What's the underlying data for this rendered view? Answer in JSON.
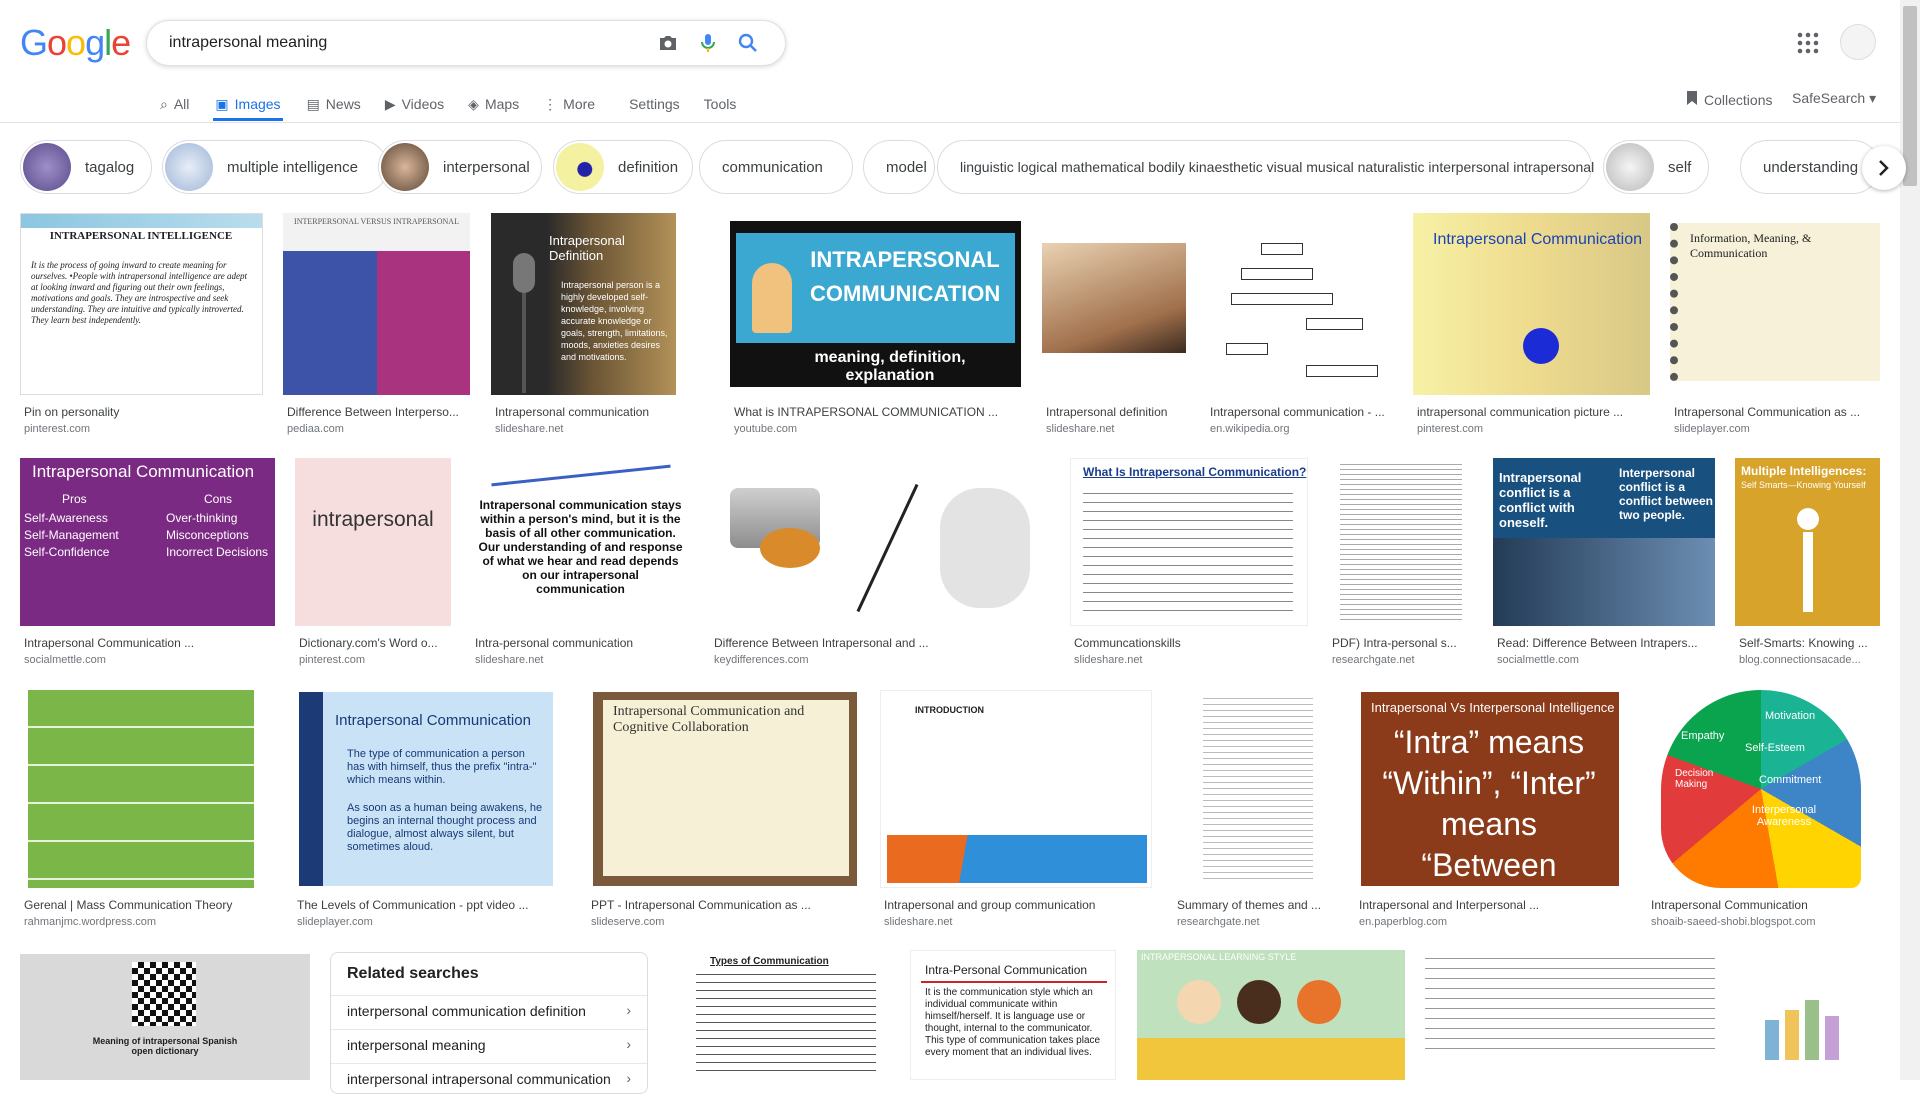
{
  "search": {
    "query": "intrapersonal meaning",
    "logo": [
      "G",
      "o",
      "o",
      "g",
      "l",
      "e"
    ]
  },
  "tabs": [
    {
      "label": "All",
      "icon": "search-icon"
    },
    {
      "label": "Images",
      "icon": "image-icon"
    },
    {
      "label": "News",
      "icon": "news-icon"
    },
    {
      "label": "Videos",
      "icon": "video-icon"
    },
    {
      "label": "Maps",
      "icon": "map-icon"
    },
    {
      "label": "More",
      "icon": "more-icon"
    }
  ],
  "tools": {
    "settings": "Settings",
    "tools": "Tools"
  },
  "right": {
    "collections": "Collections",
    "safesearch": "SafeSearch"
  },
  "chips": [
    "tagalog",
    "multiple intelligence",
    "interpersonal",
    "definition",
    "communication",
    "model",
    "linguistic logical mathematical bodily kinaesthetic visual musical naturalistic interpersonal intrapersonal",
    "self",
    "understanding"
  ],
  "results": [
    {
      "title": "Pin on personality",
      "source": "pinterest.com"
    },
    {
      "title": "Difference Between Interperso...",
      "source": "pediaa.com"
    },
    {
      "title": "Intrapersonal communication",
      "source": "slideshare.net"
    },
    {
      "title": "What is INTRAPERSONAL COMMUNICATION ...",
      "source": "youtube.com"
    },
    {
      "title": "Intrapersonal definition",
      "source": "slideshare.net"
    },
    {
      "title": "Intrapersonal communication - ...",
      "source": "en.wikipedia.org"
    },
    {
      "title": "intrapersonal communication picture ...",
      "source": "pinterest.com"
    },
    {
      "title": "Intrapersonal Communication as ...",
      "source": "slideplayer.com"
    },
    {
      "title": "Intrapersonal Communication ...",
      "source": "socialmettle.com"
    },
    {
      "title": "Dictionary.com's Word o...",
      "source": "pinterest.com"
    },
    {
      "title": "Intra-personal communication",
      "source": "slideshare.net"
    },
    {
      "title": "Difference Between Intrapersonal and ...",
      "source": "keydifferences.com"
    },
    {
      "title": "Communcationskills",
      "source": "slideshare.net"
    },
    {
      "title": "PDF) Intra-personal s...",
      "source": "researchgate.net"
    },
    {
      "title": "Read: Difference Between Intrapers...",
      "source": "socialmettle.com"
    },
    {
      "title": "Self-Smarts: Knowing ...",
      "source": "blog.connectionsacade..."
    },
    {
      "title": "Gerenal | Mass Communication Theory",
      "source": "rahmanjmc.wordpress.com"
    },
    {
      "title": "The Levels of Communication - ppt video ...",
      "source": "slideplayer.com"
    },
    {
      "title": "PPT - Intrapersonal Communication as ...",
      "source": "slideserve.com"
    },
    {
      "title": "Intrapersonal and group communication",
      "source": "slideshare.net"
    },
    {
      "title": "Summary of themes and ...",
      "source": "researchgate.net"
    },
    {
      "title": "Intrapersonal and Interpersonal ...",
      "source": "en.paperblog.com"
    },
    {
      "title": "Intrapersonal Communication",
      "source": "shoaib-saeed-shobi.blogspot.com"
    }
  ],
  "thumb_text": {
    "t1_head": "INTRAPERSONAL INTELLIGENCE",
    "t1_body": "It is the process of going inward to create meaning for ourselves. •People with intrapersonal intelligence are adept at looking inward and figuring out their own feelings, motivations and goals. They are introspective and seek understanding. They are intuitive and typically introverted. They learn best independently.",
    "t2_head": "INTERPERSONAL VERSUS INTRAPERSONAL",
    "t3_head": "Intrapersonal Definition",
    "t3_body": "Intrapersonal person is a highly developed self-knowledge, involving accurate knowledge or goals, strength, limitations, moods, anxieties desires and motivations.",
    "t4_head": "INTRAPERSONAL COMMUNICATION",
    "t4_sub": "meaning, definition, explanation",
    "t7_head": "Intrapersonal Communication",
    "t8_head": "Information, Meaning, & Communication",
    "t9_head": "Intrapersonal Communication",
    "t9_pros": "Pros",
    "t9_cons": "Cons",
    "t9_left": "Self-Awareness Self-Management Self-Confidence",
    "t9_right": "Over-thinking Misconceptions Incorrect Decisions",
    "t10_word": "intrapersonal",
    "t11_body": "Intrapersonal communication stays within a person's mind, but it is the basis of all other communication. Our understanding of and response of what we hear and read depends on our intrapersonal communication",
    "t13_head": "What Is Intrapersonal Communication?",
    "t15_l": "Intrapersonal conflict is a conflict with oneself.",
    "t15_r": "Interpersonal conflict is a conflict between two people.",
    "t16_head": "Multiple Intelligences:",
    "t16_sub": "Self Smarts—Knowing Yourself",
    "t18_head": "Intrapersonal Communication",
    "t18_b1": "The type of communication a person has with himself, thus the prefix \"intra-\" which means within.",
    "t18_b2": "As soon as a human being awakens, he begins an internal thought process and dialogue, almost always silent, but sometimes aloud.",
    "t19_head": "Intrapersonal Communication and Cognitive Collaboration",
    "t20_head": "INTRODUCTION",
    "t22_head": "Intrapersonal Vs Interpersonal Intelligence",
    "t22_body": "“Intra” means “Within”, “Inter” means “Between",
    "t23_words": [
      "Motivation",
      "Empathy",
      "Self-Esteem",
      "Decision Making",
      "Commitment",
      "Interpersonal Awareness"
    ],
    "qr_text": "Meaning of intrapersonal Spanish open dictionary",
    "types_head": "Types of Communication",
    "intra_head": "Intra-Personal Communication",
    "intra_body": "It is the communication style which an individual communicate within himself/herself. It is language use or thought, internal to the communicator. This type of communication takes place every moment that an individual lives.",
    "learn_head": "INTRAPERSONAL LEARNING STYLE"
  },
  "related": {
    "heading": "Related searches",
    "items": [
      "interpersonal communication definition",
      "interpersonal meaning",
      "interpersonal intrapersonal communication"
    ]
  },
  "colors": {
    "accent": "#1a73e8",
    "purple": "#7b2a83",
    "brown": "#8b3a1a",
    "gold": "#d7a32a"
  }
}
